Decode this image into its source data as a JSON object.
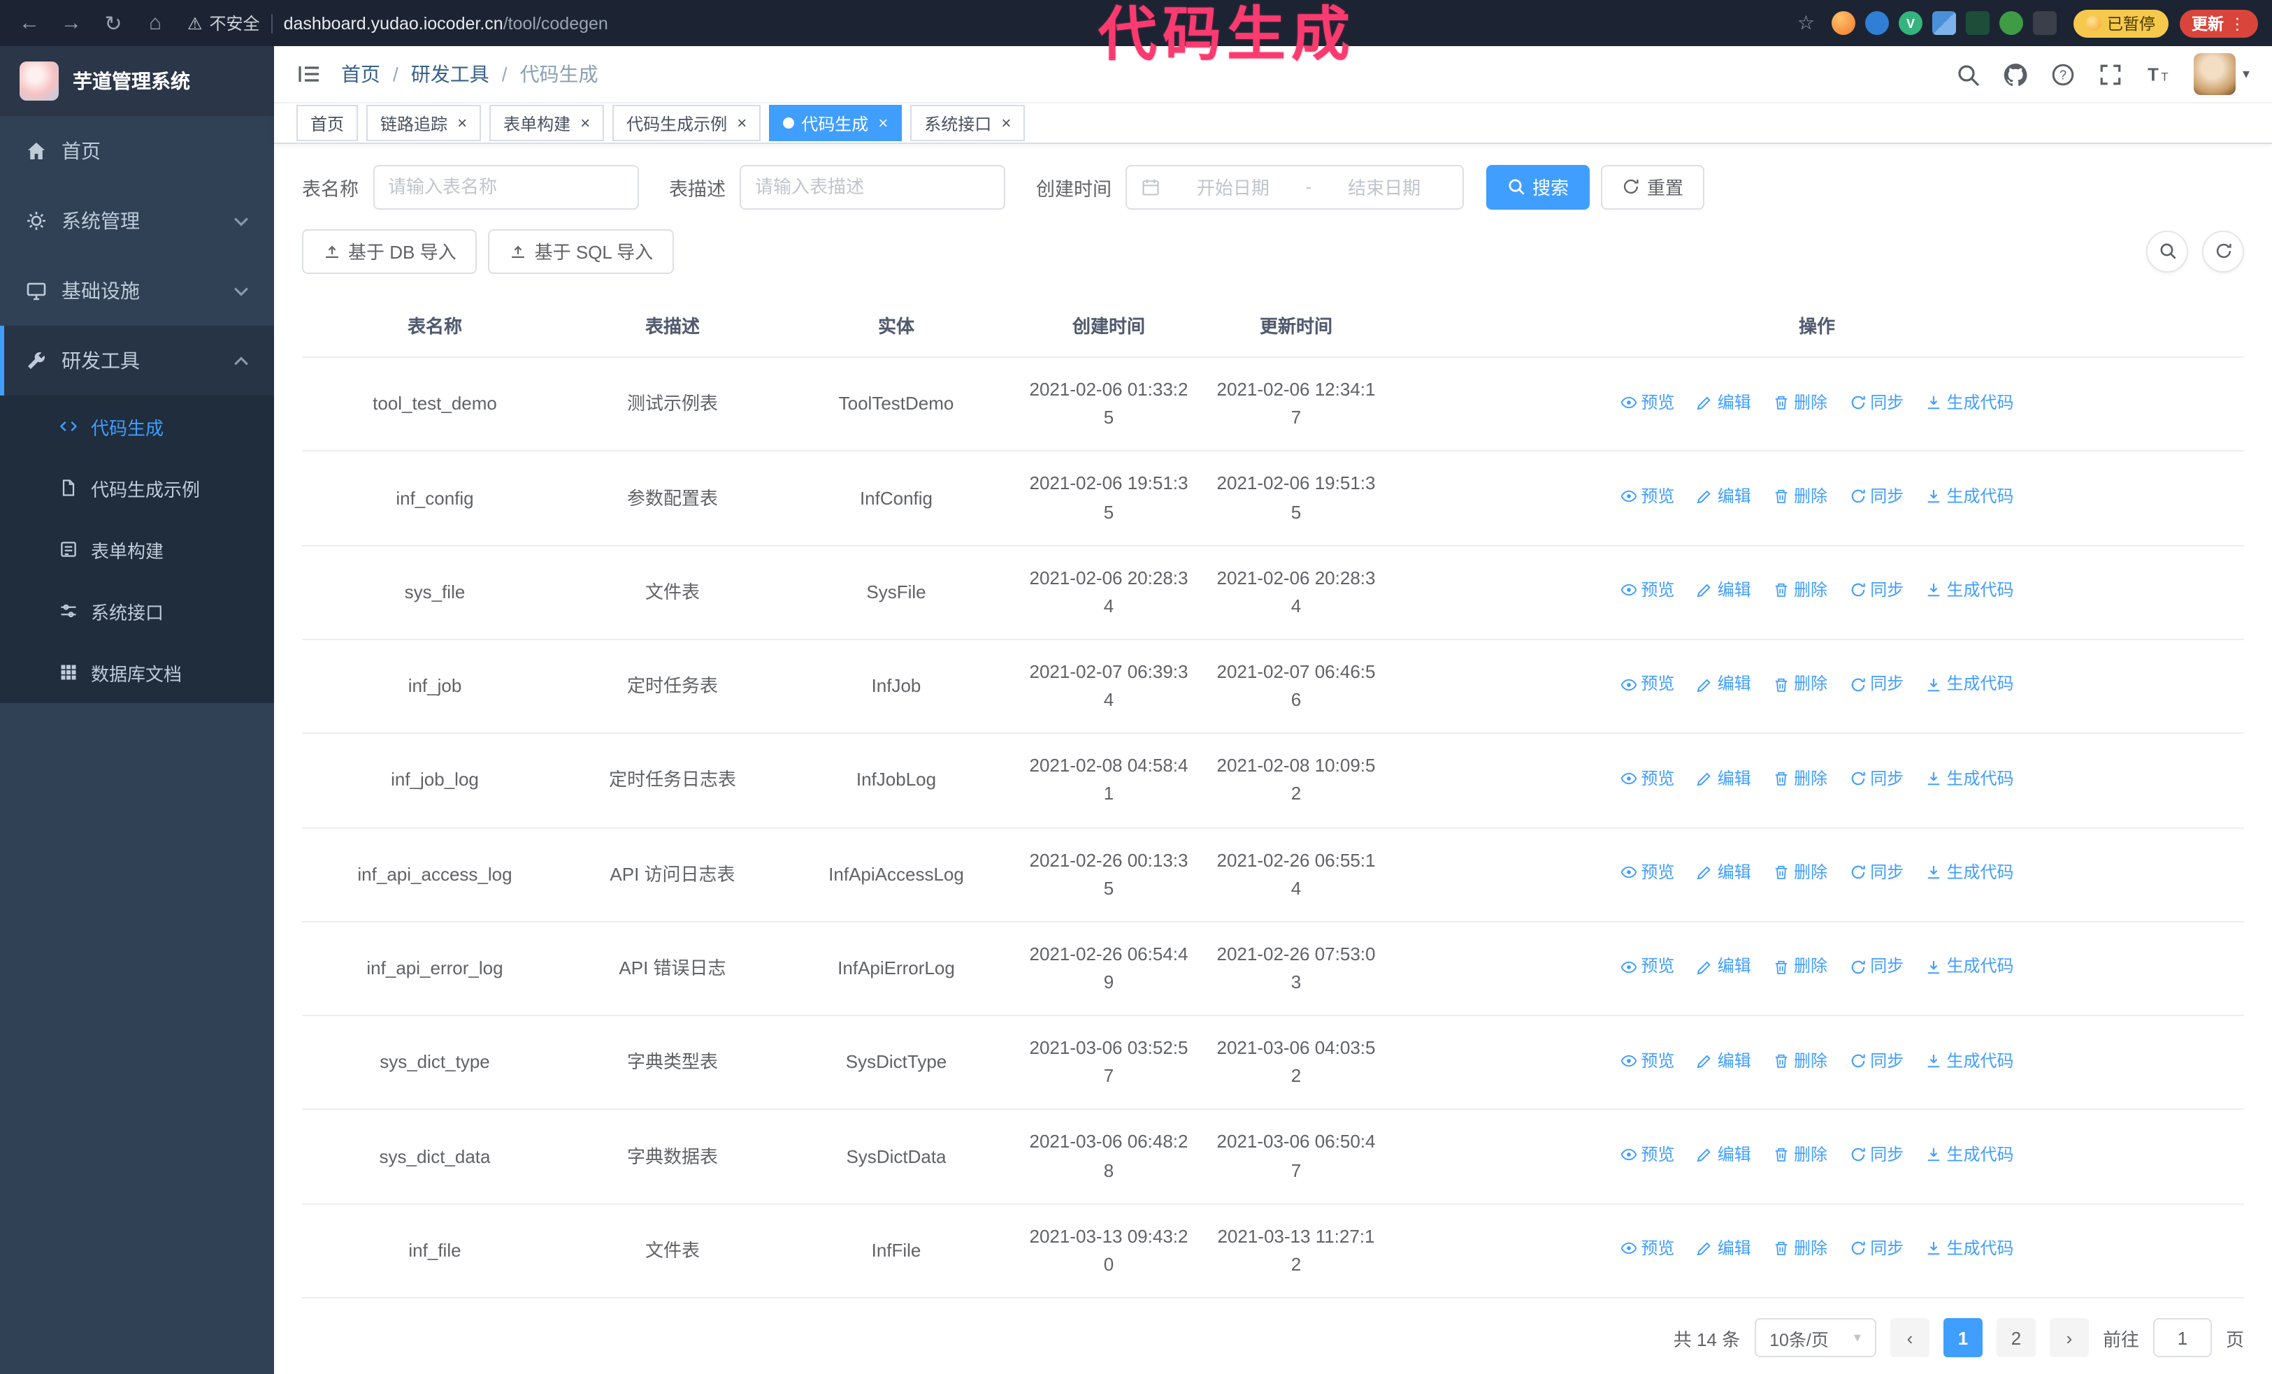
{
  "browser": {
    "security_label": "不安全",
    "url_host": "dashboard.yudao.iocoder.cn",
    "url_path": "/tool/codegen",
    "paused_badge": "已暂停",
    "update_button": "更新"
  },
  "annotation": {
    "text": "代码生成"
  },
  "icons": {
    "back": "←",
    "forward": "→",
    "reload": "↻",
    "home": "⌂",
    "warning": "⚠",
    "star": "☆",
    "menu_dots": "⋮",
    "caret_down": "▾",
    "close": "×",
    "prev": "‹",
    "next": "›",
    "ext_v": "V"
  },
  "colors": {
    "accent": "#409eff",
    "sidebar_bg": "#304156",
    "submenu_bg": "#1f2d3d",
    "annotation_pink": "#fb3b6f",
    "update_red": "#d9453a",
    "paused_yellow": "#f6c94c"
  },
  "sidebar": {
    "logo_title": "芋道管理系统",
    "items": [
      {
        "label": "首页"
      },
      {
        "label": "系统管理"
      },
      {
        "label": "基础设施"
      },
      {
        "label": "研发工具",
        "expanded": true
      }
    ],
    "subitems": [
      {
        "label": "代码生成",
        "active": true
      },
      {
        "label": "代码生成示例"
      },
      {
        "label": "表单构建"
      },
      {
        "label": "系统接口"
      },
      {
        "label": "数据库文档"
      }
    ]
  },
  "breadcrumb": {
    "items": [
      "首页",
      "研发工具",
      "代码生成"
    ],
    "separator": "/"
  },
  "tabs": [
    {
      "label": "首页"
    },
    {
      "label": "链路追踪",
      "closable": true
    },
    {
      "label": "表单构建",
      "closable": true
    },
    {
      "label": "代码生成示例",
      "closable": true
    },
    {
      "label": "代码生成",
      "closable": true,
      "active": true
    },
    {
      "label": "系统接口",
      "closable": true
    }
  ],
  "filters": {
    "table_name_label": "表名称",
    "table_name_placeholder": "请输入表名称",
    "table_desc_label": "表描述",
    "table_desc_placeholder": "请输入表描述",
    "create_time_label": "创建时间",
    "date_start_placeholder": "开始日期",
    "date_separator": "-",
    "date_end_placeholder": "结束日期",
    "search_button": "搜索",
    "reset_button": "重置"
  },
  "toolbar": {
    "import_db": "基于 DB 导入",
    "import_sql": "基于 SQL 导入"
  },
  "table": {
    "columns": [
      "表名称",
      "表描述",
      "实体",
      "创建时间",
      "更新时间",
      "操作"
    ],
    "actions": [
      "预览",
      "编辑",
      "删除",
      "同步",
      "生成代码"
    ],
    "rows": [
      {
        "name": "tool_test_demo",
        "desc": "测试示例表",
        "entity": "ToolTestDemo",
        "created": "2021-02-06 01:33:25",
        "updated": "2021-02-06 12:34:17"
      },
      {
        "name": "inf_config",
        "desc": "参数配置表",
        "entity": "InfConfig",
        "created": "2021-02-06 19:51:35",
        "updated": "2021-02-06 19:51:35"
      },
      {
        "name": "sys_file",
        "desc": "文件表",
        "entity": "SysFile",
        "created": "2021-02-06 20:28:34",
        "updated": "2021-02-06 20:28:34"
      },
      {
        "name": "inf_job",
        "desc": "定时任务表",
        "entity": "InfJob",
        "created": "2021-02-07 06:39:34",
        "updated": "2021-02-07 06:46:56"
      },
      {
        "name": "inf_job_log",
        "desc": "定时任务日志表",
        "entity": "InfJobLog",
        "created": "2021-02-08 04:58:41",
        "updated": "2021-02-08 10:09:52"
      },
      {
        "name": "inf_api_access_log",
        "desc": "API 访问日志表",
        "entity": "InfApiAccessLog",
        "created": "2021-02-26 00:13:35",
        "updated": "2021-02-26 06:55:14"
      },
      {
        "name": "inf_api_error_log",
        "desc": "API 错误日志",
        "entity": "InfApiErrorLog",
        "created": "2021-02-26 06:54:49",
        "updated": "2021-02-26 07:53:03"
      },
      {
        "name": "sys_dict_type",
        "desc": "字典类型表",
        "entity": "SysDictType",
        "created": "2021-03-06 03:52:57",
        "updated": "2021-03-06 04:03:52"
      },
      {
        "name": "sys_dict_data",
        "desc": "字典数据表",
        "entity": "SysDictData",
        "created": "2021-03-06 06:48:28",
        "updated": "2021-03-06 06:50:47"
      },
      {
        "name": "inf_file",
        "desc": "文件表",
        "entity": "InfFile",
        "created": "2021-03-13 09:43:20",
        "updated": "2021-03-13 11:27:12"
      }
    ]
  },
  "pagination": {
    "total": "共 14 条",
    "page_size": "10条/页",
    "pages": [
      {
        "label": "1",
        "active": true
      },
      {
        "label": "2"
      }
    ],
    "goto_label": "前往",
    "goto_value": "1",
    "goto_suffix": "页"
  }
}
